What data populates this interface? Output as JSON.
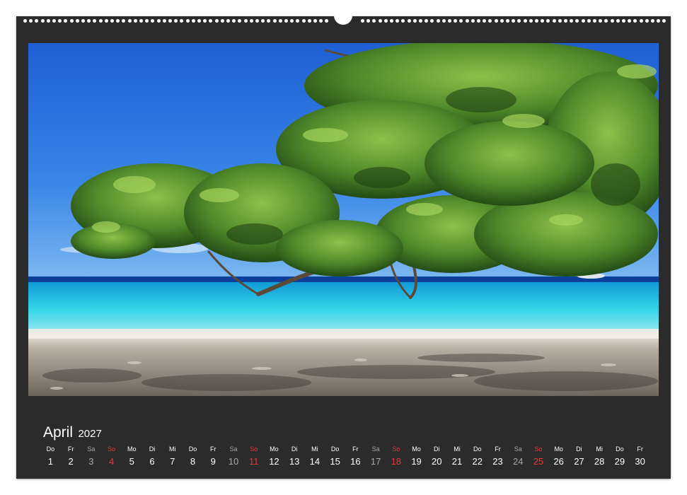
{
  "calendar": {
    "month": "April",
    "year": "2027",
    "days": [
      {
        "wd": "Do",
        "n": "1",
        "type": "weekday"
      },
      {
        "wd": "Fr",
        "n": "2",
        "type": "weekday"
      },
      {
        "wd": "Sa",
        "n": "3",
        "type": "sat"
      },
      {
        "wd": "So",
        "n": "4",
        "type": "sun"
      },
      {
        "wd": "Mo",
        "n": "5",
        "type": "weekday"
      },
      {
        "wd": "Di",
        "n": "6",
        "type": "weekday"
      },
      {
        "wd": "Mi",
        "n": "7",
        "type": "weekday"
      },
      {
        "wd": "Do",
        "n": "8",
        "type": "weekday"
      },
      {
        "wd": "Fr",
        "n": "9",
        "type": "weekday"
      },
      {
        "wd": "Sa",
        "n": "10",
        "type": "sat"
      },
      {
        "wd": "So",
        "n": "11",
        "type": "sun"
      },
      {
        "wd": "Mo",
        "n": "12",
        "type": "weekday"
      },
      {
        "wd": "Di",
        "n": "13",
        "type": "weekday"
      },
      {
        "wd": "Mi",
        "n": "14",
        "type": "weekday"
      },
      {
        "wd": "Do",
        "n": "15",
        "type": "weekday"
      },
      {
        "wd": "Fr",
        "n": "16",
        "type": "weekday"
      },
      {
        "wd": "Sa",
        "n": "17",
        "type": "sat"
      },
      {
        "wd": "So",
        "n": "18",
        "type": "sun"
      },
      {
        "wd": "Mo",
        "n": "19",
        "type": "weekday"
      },
      {
        "wd": "Di",
        "n": "20",
        "type": "weekday"
      },
      {
        "wd": "Mi",
        "n": "21",
        "type": "weekday"
      },
      {
        "wd": "Do",
        "n": "22",
        "type": "weekday"
      },
      {
        "wd": "Fr",
        "n": "23",
        "type": "weekday"
      },
      {
        "wd": "Sa",
        "n": "24",
        "type": "sat"
      },
      {
        "wd": "So",
        "n": "25",
        "type": "sun"
      },
      {
        "wd": "Mo",
        "n": "26",
        "type": "weekday"
      },
      {
        "wd": "Di",
        "n": "27",
        "type": "weekday"
      },
      {
        "wd": "Mi",
        "n": "28",
        "type": "weekday"
      },
      {
        "wd": "Do",
        "n": "29",
        "type": "weekday"
      },
      {
        "wd": "Fr",
        "n": "30",
        "type": "weekday"
      }
    ]
  },
  "colors": {
    "frame": "#2b2b2b",
    "sunday": "#e83a3a",
    "saturday": "#a9a9a9",
    "text": "#ffffff"
  },
  "photo": {
    "subject": "tropical-beach-with-tree-branches"
  }
}
